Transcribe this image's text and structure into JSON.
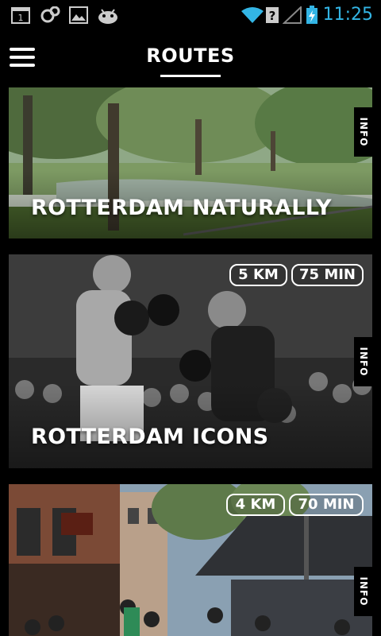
{
  "status_bar": {
    "time": "11:25",
    "icons": [
      "calendar-icon",
      "sync-icon",
      "image-icon",
      "android-icon",
      "wifi-icon",
      "signal-icon",
      "battery-charging-icon"
    ],
    "calendar_day": "1",
    "accent_color": "#33b5e5"
  },
  "header": {
    "title": "ROUTES",
    "menu_icon": "hamburger-menu-icon"
  },
  "routes": [
    {
      "name": "ROTTERDAM NATURALLY",
      "info_label": "INFO"
    },
    {
      "name": "ROTTERDAM ICONS",
      "distance": "5 KM",
      "duration": "75 MIN",
      "info_label": "INFO"
    },
    {
      "name": "",
      "distance": "4 KM",
      "duration": "70 MIN",
      "info_label": "INFO"
    }
  ]
}
